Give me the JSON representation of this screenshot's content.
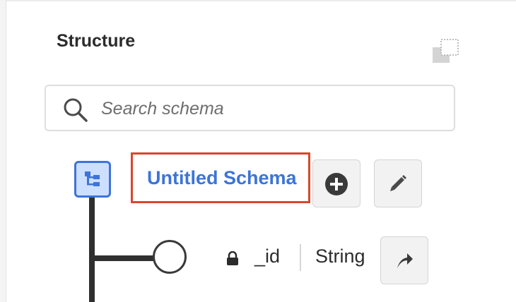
{
  "panel": {
    "title": "Structure"
  },
  "search": {
    "placeholder": "Search schema",
    "value": ""
  },
  "schema": {
    "name": "Untitled Schema",
    "fields": [
      {
        "name": "_id",
        "type": "String",
        "locked": true
      }
    ]
  },
  "icons": {
    "panel_toggle": "panel-toggle-icon",
    "search": "search-icon",
    "root": "schema-tree-icon",
    "add": "add-circle-icon",
    "edit": "pencil-icon",
    "lock": "lock-icon",
    "open": "open-arrow-icon"
  },
  "colors": {
    "accent": "#3d74d8",
    "highlight_border": "#d9472b",
    "root_icon_bg": "#ccdfff"
  }
}
